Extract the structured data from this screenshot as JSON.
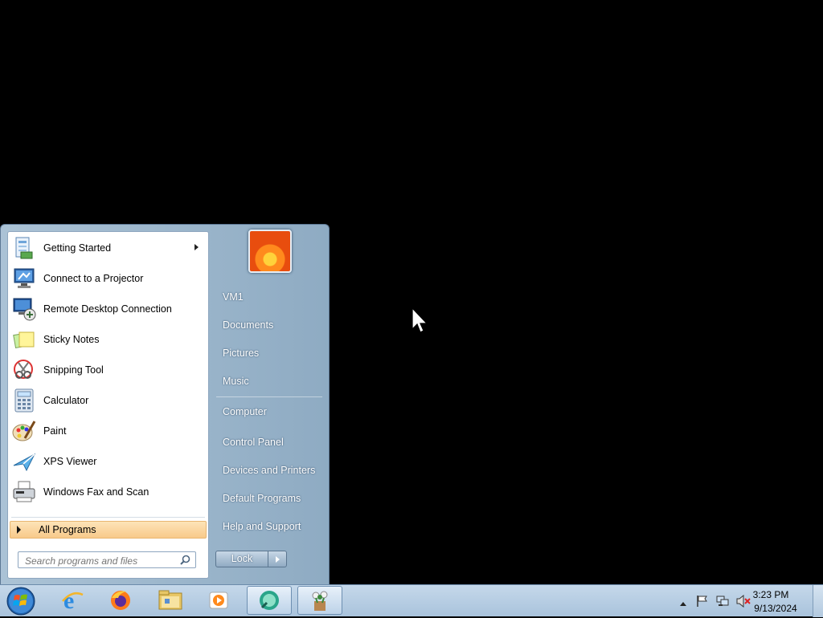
{
  "start_menu": {
    "programs": [
      {
        "label": "Getting Started",
        "icon": "getting-started-icon",
        "has_submenu": true
      },
      {
        "label": "Connect to a Projector",
        "icon": "projector-icon",
        "has_submenu": false
      },
      {
        "label": "Remote Desktop Connection",
        "icon": "remote-desktop-icon",
        "has_submenu": false
      },
      {
        "label": "Sticky Notes",
        "icon": "sticky-notes-icon",
        "has_submenu": false
      },
      {
        "label": "Snipping Tool",
        "icon": "snipping-tool-icon",
        "has_submenu": false
      },
      {
        "label": "Calculator",
        "icon": "calculator-icon",
        "has_submenu": false
      },
      {
        "label": "Paint",
        "icon": "paint-icon",
        "has_submenu": false
      },
      {
        "label": "XPS Viewer",
        "icon": "xps-viewer-icon",
        "has_submenu": false
      },
      {
        "label": "Windows Fax and Scan",
        "icon": "fax-scan-icon",
        "has_submenu": false
      }
    ],
    "all_programs_label": "All Programs",
    "search_placeholder": "Search programs and files",
    "right_links": [
      {
        "label": "VM1"
      },
      {
        "label": "Documents"
      },
      {
        "label": "Pictures"
      },
      {
        "label": "Music"
      },
      {
        "label": "Computer"
      },
      {
        "label": "Control Panel"
      },
      {
        "label": "Devices and Printers"
      },
      {
        "label": "Default Programs"
      },
      {
        "label": "Help and Support"
      }
    ],
    "lock_label": "Lock"
  },
  "taskbar": {
    "pinned": [
      {
        "name": "internet-explorer-icon"
      },
      {
        "name": "firefox-icon"
      },
      {
        "name": "windows-explorer-icon"
      },
      {
        "name": "media-player-icon"
      },
      {
        "name": "green-app-icon",
        "active": true
      },
      {
        "name": "app-flowers-icon"
      }
    ],
    "clock": {
      "time": "3:23 PM",
      "date": "9/13/2024"
    }
  },
  "colors": {
    "highlight": "#f8c98a",
    "taskbar": "#b8cfe5"
  }
}
